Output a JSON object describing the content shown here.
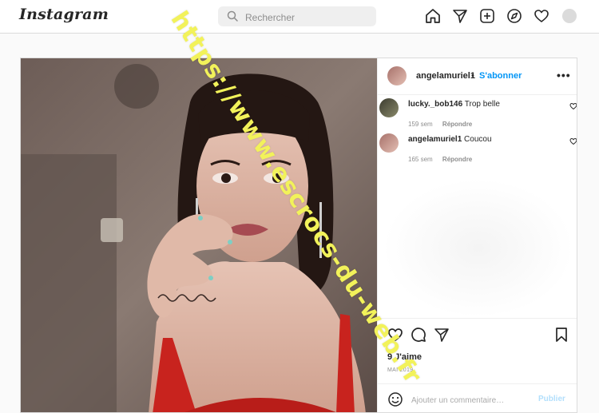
{
  "header": {
    "logo": "Instagram",
    "search_placeholder": "Rechercher",
    "nav_icons": [
      "home-icon",
      "direct-icon",
      "new-post-icon",
      "explore-icon",
      "activity-icon",
      "profile-avatar"
    ]
  },
  "post": {
    "author": "angelamuriel1",
    "separator": "•",
    "follow_label": "S'abonner",
    "more_label": "•••",
    "comments": [
      {
        "user": "lucky._bob146",
        "text": "Trop belle",
        "age": "159 sem",
        "reply": "Répondre"
      },
      {
        "user": "angelamuriel1",
        "text": "Coucou",
        "age": "165 sem",
        "reply": "Répondre"
      }
    ],
    "likes": "9 J'aime",
    "date": "MAI 2019",
    "add_comment_placeholder": "Ajouter un commentaire…",
    "publish_label": "Publier"
  },
  "watermark": "https://www.escrocs-du-web.fr",
  "colors": {
    "accent": "#0095f6",
    "publish_disabled": "#b2dffc",
    "watermark": "#f2f25a",
    "dress": "#c8231e"
  }
}
